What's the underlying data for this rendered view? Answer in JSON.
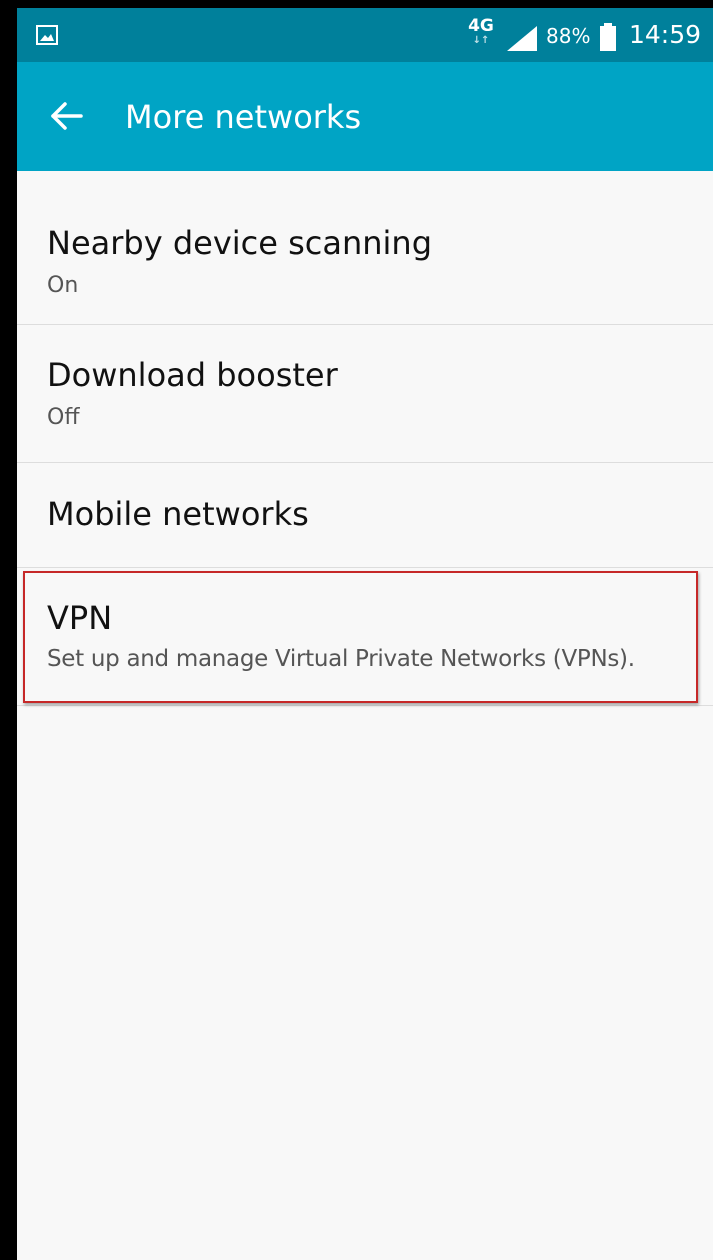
{
  "status_bar": {
    "network_type": "4G",
    "network_arrows": "↓↑",
    "battery_percent": "88%",
    "time": "14:59"
  },
  "app_bar": {
    "title": "More networks",
    "color": "#00a4c5",
    "status_color": "#00809b"
  },
  "settings": [
    {
      "title": "Nearby device scanning",
      "subtitle": "On"
    },
    {
      "title": "Download booster",
      "subtitle": "Off"
    },
    {
      "title": "Mobile networks",
      "subtitle": ""
    },
    {
      "title": "VPN",
      "subtitle": "Set up and manage Virtual Private Networks (VPNs)."
    }
  ],
  "highlight": {
    "target": "VPN",
    "color": "#c62828"
  },
  "icons": {
    "status_left": "gallery-icon",
    "signal": "signal-strength-icon",
    "battery": "battery-icon",
    "back": "back-arrow-icon"
  }
}
